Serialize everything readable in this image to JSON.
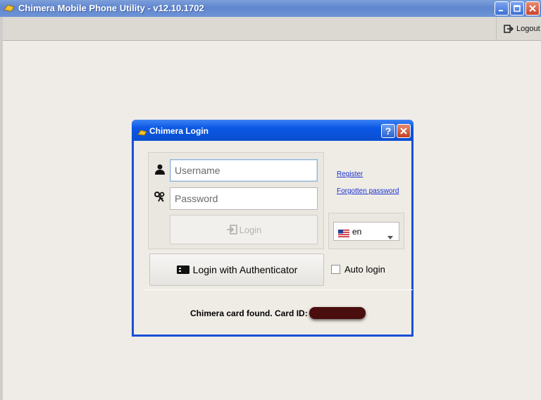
{
  "window": {
    "title": "Chimera Mobile Phone Utility - v12.10.1702",
    "controls": [
      "minimize",
      "maximize",
      "close"
    ]
  },
  "toolbar": {
    "logout_label": "Logout",
    "logout_icon": "logout-icon"
  },
  "dialog": {
    "title": "Chimera Login",
    "help_label": "?",
    "username": {
      "value": "",
      "placeholder": "Username",
      "icon": "user-icon"
    },
    "password": {
      "value": "",
      "placeholder": "Password",
      "icon": "keys-icon"
    },
    "login_label": "Login",
    "register_link": "Register",
    "forgot_link": "Forgotten password",
    "language": {
      "selected": "en",
      "flag": "us-flag-icon"
    },
    "auth_button_label": "Login with Authenticator",
    "auto_login_label": "Auto login",
    "auto_login_checked": false,
    "status_text": "Chimera card found. Card ID:"
  },
  "colors": {
    "dialog_border": "#1a4fd6",
    "window_title_bar": "#6e93d6",
    "link": "#1a2fd0",
    "background": "#efece8"
  }
}
